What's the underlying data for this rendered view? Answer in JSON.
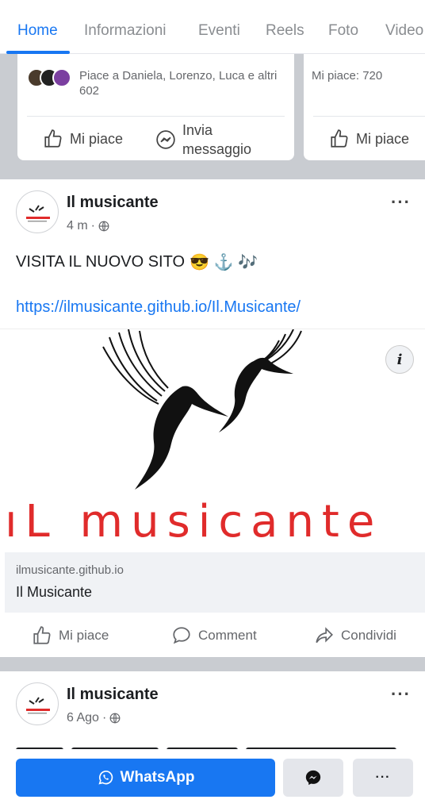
{
  "tabs": [
    {
      "label": "Home",
      "active": true
    },
    {
      "label": "Informazioni"
    },
    {
      "label": "Eventi"
    },
    {
      "label": "Reels"
    },
    {
      "label": "Foto"
    },
    {
      "label": "Video"
    }
  ],
  "card1": {
    "likes_text": "Piace a Daniela, Lorenzo, Luca e altri 602",
    "like_label": "Mi piace",
    "message_label_line1": "Invia",
    "message_label_line2": "messaggio"
  },
  "card2": {
    "likes_text": "Mi piace: 720",
    "like_label": "Mi piace"
  },
  "post1": {
    "author": "Il musicante",
    "time": "4 m",
    "text": "VISITA IL NUOVO SITO",
    "emojis": "😎 ⚓ 🎶",
    "link": "https://ilmusicante.github.io/Il.Musicante/",
    "image_brand": "ıL musicante",
    "info_icon": "i",
    "link_domain": "ilmusicante.github.io",
    "link_title": "Il Musicante",
    "actions": {
      "like": "Mi piace",
      "comment": "Comment",
      "share": "Condividi"
    }
  },
  "post2": {
    "author": "Il musicante",
    "time": "6 Ago"
  },
  "bottom_bar": {
    "whatsapp_label": "WhatsApp",
    "more_label": "···"
  },
  "colors": {
    "accent": "#1877f2",
    "brand_red": "#e02b2b",
    "separator": "#c9ccd1"
  },
  "icons": [
    "like-icon",
    "messenger-icon",
    "comment-icon",
    "share-icon",
    "globe-icon",
    "whatsapp-icon",
    "info-icon"
  ]
}
